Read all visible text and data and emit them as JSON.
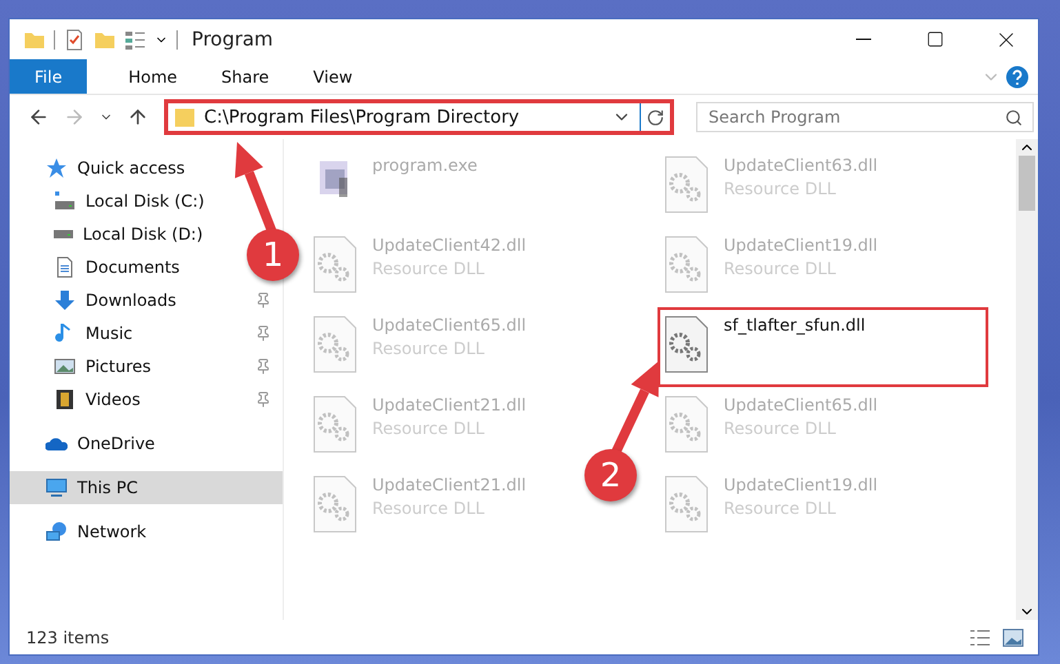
{
  "window": {
    "title": "Program"
  },
  "ribbon_tabs": [
    {
      "label": "File",
      "kind": "file"
    },
    {
      "label": "Home",
      "kind": "tab"
    },
    {
      "label": "Share",
      "kind": "tab"
    },
    {
      "label": "View",
      "kind": "tab"
    }
  ],
  "address": {
    "path": "C:\\Program Files\\Program Directory",
    "highlighted": true
  },
  "search": {
    "placeholder": "Search Program"
  },
  "sidebar": {
    "items": [
      {
        "label": "Quick access",
        "kind": "star",
        "selected": false,
        "children": [
          {
            "label": "Local Disk (C:)",
            "kind": "disk_c",
            "pinned": false,
            "selected": false
          },
          {
            "label": "Local Disk (D:)",
            "kind": "disk",
            "pinned": false,
            "selected": false
          },
          {
            "label": "Documents",
            "kind": "document",
            "pinned": false,
            "selected": false
          },
          {
            "label": "Downloads",
            "kind": "download",
            "pinned": true,
            "selected": false
          },
          {
            "label": "Music",
            "kind": "music",
            "pinned": true,
            "selected": false
          },
          {
            "label": "Pictures",
            "kind": "pictures",
            "pinned": true,
            "selected": false
          },
          {
            "label": "Videos",
            "kind": "videos",
            "pinned": true,
            "selected": false
          }
        ]
      },
      {
        "label": "OneDrive",
        "kind": "cloud",
        "selected": false
      },
      {
        "label": "This PC",
        "kind": "pc",
        "selected": true
      },
      {
        "label": "Network",
        "kind": "network",
        "selected": false
      }
    ]
  },
  "files": [
    {
      "name": "program.exe",
      "kind": "exe",
      "highlighted": false
    },
    {
      "name": "UpdateClient63.dll",
      "type": "Resource DLL",
      "kind": "dll",
      "highlighted": false
    },
    {
      "name": "UpdateClient42.dll",
      "type": "Resource DLL",
      "kind": "dll",
      "highlighted": false
    },
    {
      "name": "UpdateClient19.dll",
      "type": "Resource DLL",
      "kind": "dll",
      "highlighted": false
    },
    {
      "name": "UpdateClient65.dll",
      "type": "Resource DLL",
      "kind": "dll",
      "highlighted": false
    },
    {
      "name": "sf_tlafter_sfun.dll",
      "kind": "dll",
      "highlighted": true
    },
    {
      "name": "UpdateClient21.dll",
      "type": "Resource DLL",
      "kind": "dll",
      "highlighted": false
    },
    {
      "name": "UpdateClient65.dll",
      "type": "Resource DLL",
      "kind": "dll",
      "highlighted": false
    },
    {
      "name": "UpdateClient21.dll",
      "type": "Resource DLL",
      "kind": "dll",
      "highlighted": false
    },
    {
      "name": "UpdateClient19.dll",
      "type": "Resource DLL",
      "kind": "dll",
      "highlighted": false
    }
  ],
  "status_bar": {
    "count": "123 items"
  },
  "annotations": [
    {
      "number": "1"
    },
    {
      "number": "2"
    }
  ]
}
